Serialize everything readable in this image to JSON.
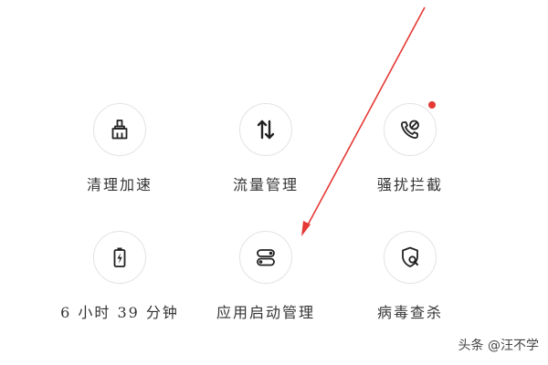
{
  "colors": {
    "icon_stroke": "#222222",
    "label_text": "#333333",
    "badge": "#e53935",
    "arrow": "#e53935"
  },
  "grid": {
    "items": [
      {
        "label": "清理加速",
        "icon": "broom-icon"
      },
      {
        "label": "流量管理",
        "icon": "up-down-arrows-icon"
      },
      {
        "label": "骚扰拦截",
        "icon": "phone-block-icon",
        "badge": true
      },
      {
        "label": "6 小时 39 分钟",
        "icon": "battery-icon"
      },
      {
        "label": "应用启动管理",
        "icon": "toggle-switches-icon"
      },
      {
        "label": "病毒查杀",
        "icon": "shield-search-icon"
      }
    ]
  },
  "watermark": {
    "text": "头条 @汪不学"
  }
}
